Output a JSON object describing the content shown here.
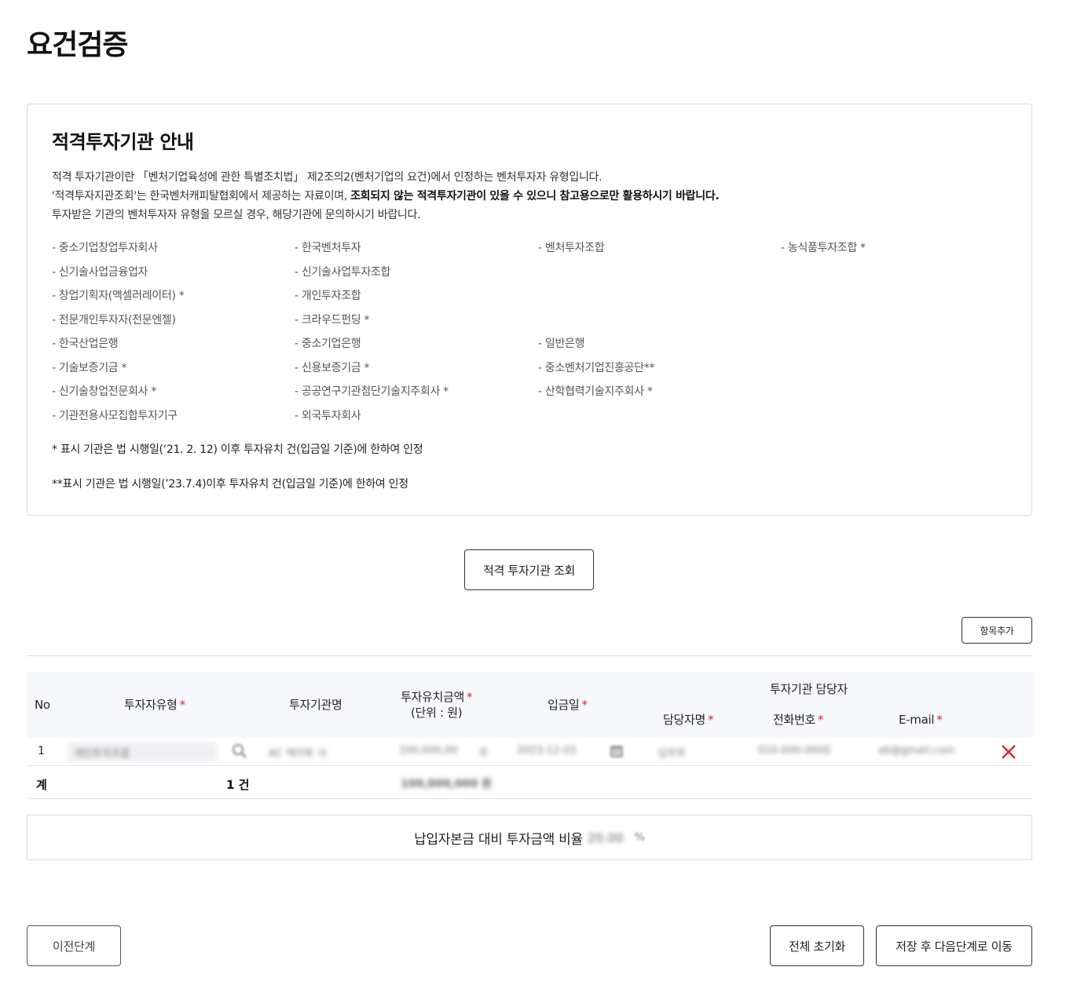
{
  "page": {
    "title": "요건검증"
  },
  "guide": {
    "title": "적격투자기관 안내",
    "line1": "적격 투자기관이란 「벤처기업육성에 관한 특별조치법」 제2조의2(벤처기업의 요건)에서 인정하는 벤처투자자 유형입니다.",
    "line2_normal": "'적격투자지관조회'는 한국벤처캐피탈협회에서 제공하는 자료이며, ",
    "line2_bold": "조회되지 않는 적격투자기관이 있을 수 있으니 참고용으로만 활용하시기 바랍니다.",
    "line3": "투자받은 기관의 벤처투자자 유형을 모르실 경우, 해당기관에 문의하시기 바랍니다.",
    "orgs": [
      [
        "- 중소기업창업투자회사",
        "- 한국벤처투자",
        "- 벤처투자조합",
        "- 농식품투자조합 *"
      ],
      [
        "- 신기술사업금융업자",
        "- 신기술사업투자조합",
        "",
        ""
      ],
      [
        "- 창업기획자(액셀러레이터) *",
        "- 개인투자조합",
        "",
        ""
      ],
      [
        "- 전문개인투자자(전문엔젤)",
        "- 크라우드펀딩 *",
        "",
        ""
      ],
      [
        "- 한국산업은행",
        "- 중소기업은행",
        "- 일반은행",
        ""
      ],
      [
        "- 기술보증기금 *",
        "- 신용보증기금 *",
        "- 중소벤처기업진흥공단**",
        ""
      ],
      [
        "- 신기술창업전문회사 *",
        "- 공공연구기관첨단기술지주회사 *",
        "- 산학협력기술지주회사 *",
        ""
      ],
      [
        "- 기관전용사모집합투자기구",
        "- 외국투자회사",
        "",
        ""
      ]
    ],
    "note1": "* 표시 기관은 법 시행일(‘21. 2. 12) 이후 투자유치 건(입금일 기준)에 한하여 인정",
    "note2": "**표시 기관은 법 시행일(’23.7.4)이후 투자유치 건(입금일 기준)에 한하여 인정"
  },
  "buttons": {
    "lookup": "적격 투자기관 조회",
    "add_item": "항목추가",
    "prev": "이전단계",
    "reset": "전체 초기화",
    "save_next": "저장 후 다음단계로 이동"
  },
  "table": {
    "headers": {
      "no": "No",
      "investor_type": "투자자유형",
      "institution": "투자기관명",
      "amount_line1": "투자유치금액",
      "amount_line2": "(단위 : 원)",
      "deposit_date": "입금일",
      "manager_group": "투자기관 담당자",
      "manager_name": "담당자명",
      "phone": "전화번호",
      "email": "E-mail"
    },
    "required_mark": "*",
    "rows": [
      {
        "no": "1",
        "investor_type": "개인투자조합",
        "institution": "AC 케이투 사",
        "amount": "100,000,00",
        "date": "2023-12-03",
        "manager": "김무무",
        "phone": "010-000-0000",
        "email": "ab@gmail.com"
      }
    ],
    "summary": {
      "label": "계",
      "count": "1 건",
      "amount": "100,000,000 원"
    }
  },
  "ratio": {
    "label": "납입자본금 대비 투자금액 비율",
    "value": "20.00",
    "unit": "%"
  },
  "colors": {
    "required": "#d9262e",
    "delete": "#e0242c"
  }
}
